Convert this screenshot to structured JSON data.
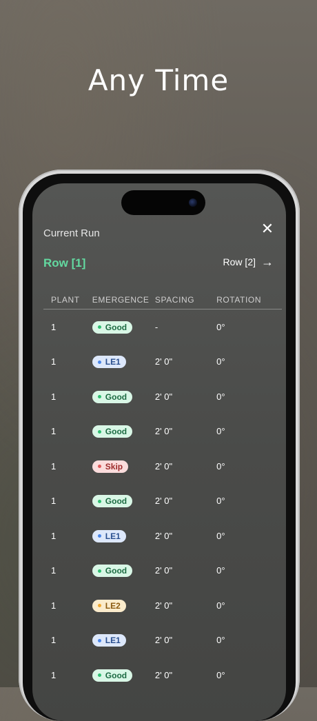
{
  "headline": "Any Time",
  "panel": {
    "title": "Current Run",
    "close_icon": "close-icon",
    "current_row": "Row [1]",
    "next_row": "Row [2]",
    "next_icon": "arrow-right-icon"
  },
  "table": {
    "headers": [
      "PLANT",
      "EMERGENCE",
      "SPACING",
      "ROTATION"
    ],
    "rows": [
      {
        "plant": "1",
        "emergence": "Good",
        "status": "good",
        "spacing": "-",
        "rotation": "0°"
      },
      {
        "plant": "1",
        "emergence": "LE1",
        "status": "le1",
        "spacing": "2' 0\"",
        "rotation": "0°"
      },
      {
        "plant": "1",
        "emergence": "Good",
        "status": "good",
        "spacing": "2' 0\"",
        "rotation": "0°"
      },
      {
        "plant": "1",
        "emergence": "Good",
        "status": "good",
        "spacing": "2' 0\"",
        "rotation": "0°"
      },
      {
        "plant": "1",
        "emergence": "Skip",
        "status": "skip",
        "spacing": "2' 0\"",
        "rotation": "0°"
      },
      {
        "plant": "1",
        "emergence": "Good",
        "status": "good",
        "spacing": "2' 0\"",
        "rotation": "0°"
      },
      {
        "plant": "1",
        "emergence": "LE1",
        "status": "le1",
        "spacing": "2' 0\"",
        "rotation": "0°"
      },
      {
        "plant": "1",
        "emergence": "Good",
        "status": "good",
        "spacing": "2' 0\"",
        "rotation": "0°"
      },
      {
        "plant": "1",
        "emergence": "LE2",
        "status": "le2",
        "spacing": "2' 0\"",
        "rotation": "0°"
      },
      {
        "plant": "1",
        "emergence": "LE1",
        "status": "le1",
        "spacing": "2' 0\"",
        "rotation": "0°"
      },
      {
        "plant": "1",
        "emergence": "Good",
        "status": "good",
        "spacing": "2' 0\"",
        "rotation": "0°"
      }
    ]
  },
  "colors": {
    "accent_green": "#63d9a0",
    "good": "#2fbf71",
    "le1": "#4a86e8",
    "skip": "#e05a5a",
    "le2": "#f0a830"
  }
}
